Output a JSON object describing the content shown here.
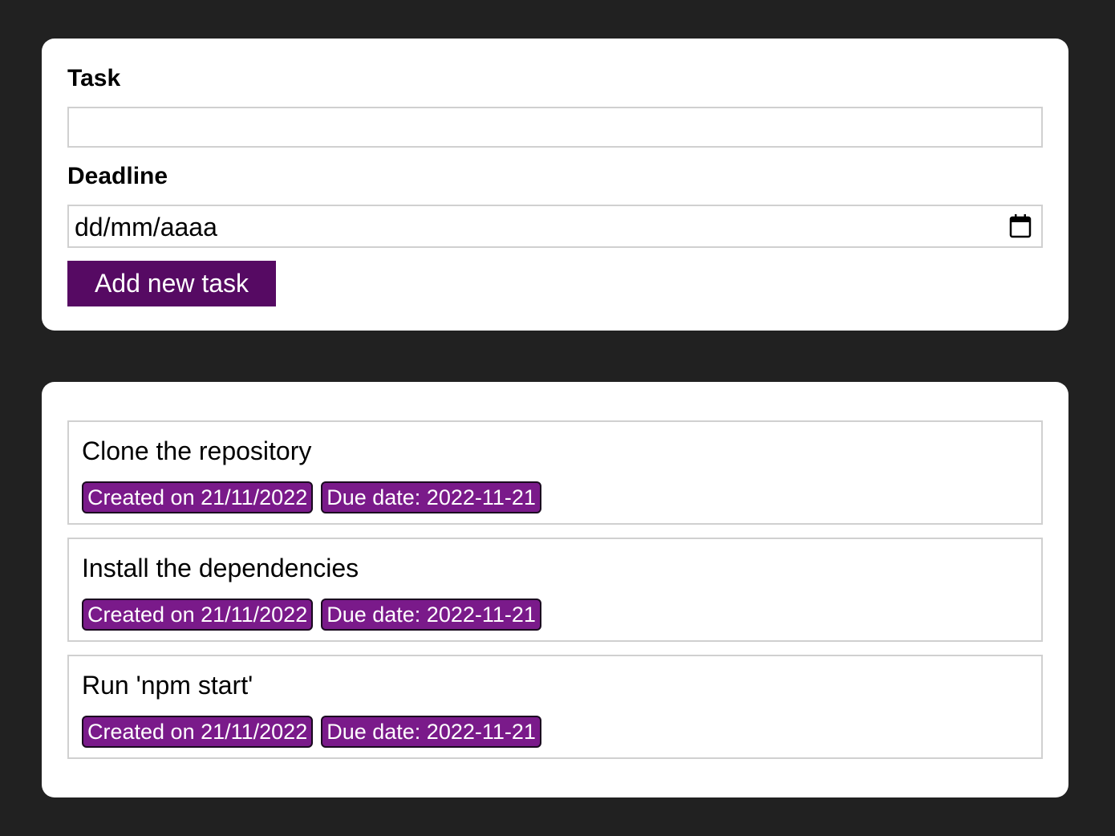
{
  "form": {
    "task_label": "Task",
    "task_value": "",
    "deadline_label": "Deadline",
    "deadline_placeholder": "dd/mm/aaaa",
    "add_button_label": "Add new task"
  },
  "tasks": [
    {
      "title": "Clone the repository",
      "created": "Created on 21/11/2022",
      "due": "Due date: 2022-11-21"
    },
    {
      "title": "Install the dependencies",
      "created": "Created on 21/11/2022",
      "due": "Due date: 2022-11-21"
    },
    {
      "title": "Run 'npm start'",
      "created": "Created on 21/11/2022",
      "due": "Due date: 2022-11-21"
    }
  ],
  "colors": {
    "background": "#212121",
    "card": "#ffffff",
    "button": "#560a63",
    "badge": "#7a1a8a"
  },
  "icons": {
    "deadline_picker": "calendar-icon"
  }
}
